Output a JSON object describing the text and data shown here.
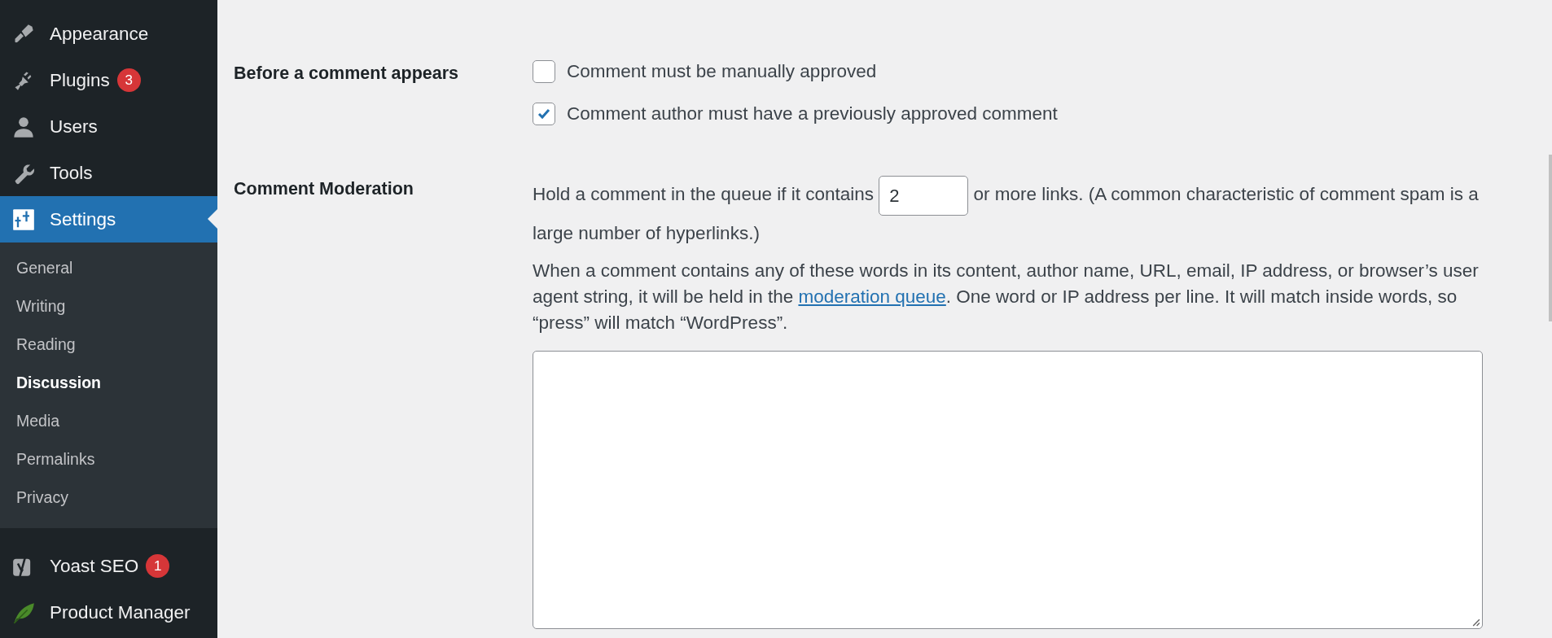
{
  "sidebar": {
    "items": [
      {
        "label": "Appearance",
        "selected": false
      },
      {
        "label": "Plugins",
        "badge": "3",
        "selected": false
      },
      {
        "label": "Users",
        "selected": false
      },
      {
        "label": "Tools",
        "selected": false
      },
      {
        "label": "Settings",
        "selected": true,
        "children": [
          {
            "label": "General",
            "selected": false
          },
          {
            "label": "Writing",
            "selected": false
          },
          {
            "label": "Reading",
            "selected": false
          },
          {
            "label": "Discussion",
            "selected": true
          },
          {
            "label": "Media",
            "selected": false
          },
          {
            "label": "Permalinks",
            "selected": false
          },
          {
            "label": "Privacy",
            "selected": false
          }
        ]
      },
      {
        "label": "Yoast SEO",
        "badge": "1",
        "selected": false
      },
      {
        "label": "Product Manager",
        "selected": false
      }
    ]
  },
  "form": {
    "rows": [
      {
        "label": "Before a comment appears",
        "kind": "checkboxes",
        "options": [
          {
            "label": "Comment must be manually approved",
            "checked": false
          },
          {
            "label": "Comment author must have a previously approved comment",
            "checked": true
          }
        ]
      },
      {
        "label": "Comment Moderation",
        "kind": "moderation",
        "links_prefix": "Hold a comment in the queue if it contains",
        "links_value": "2",
        "links_suffix": "or more links. (A common characteristic of comment spam is a large number of hyperlinks.)",
        "description_before": "When a comment contains any of these words in its content, author name, URL, email, IP address, or browser’s user agent string, it will be held in the",
        "description_link": "moderation queue",
        "description_after": ". One word or IP address per line. It will match inside words, so “press” will match “WordPress”."
      }
    ]
  }
}
